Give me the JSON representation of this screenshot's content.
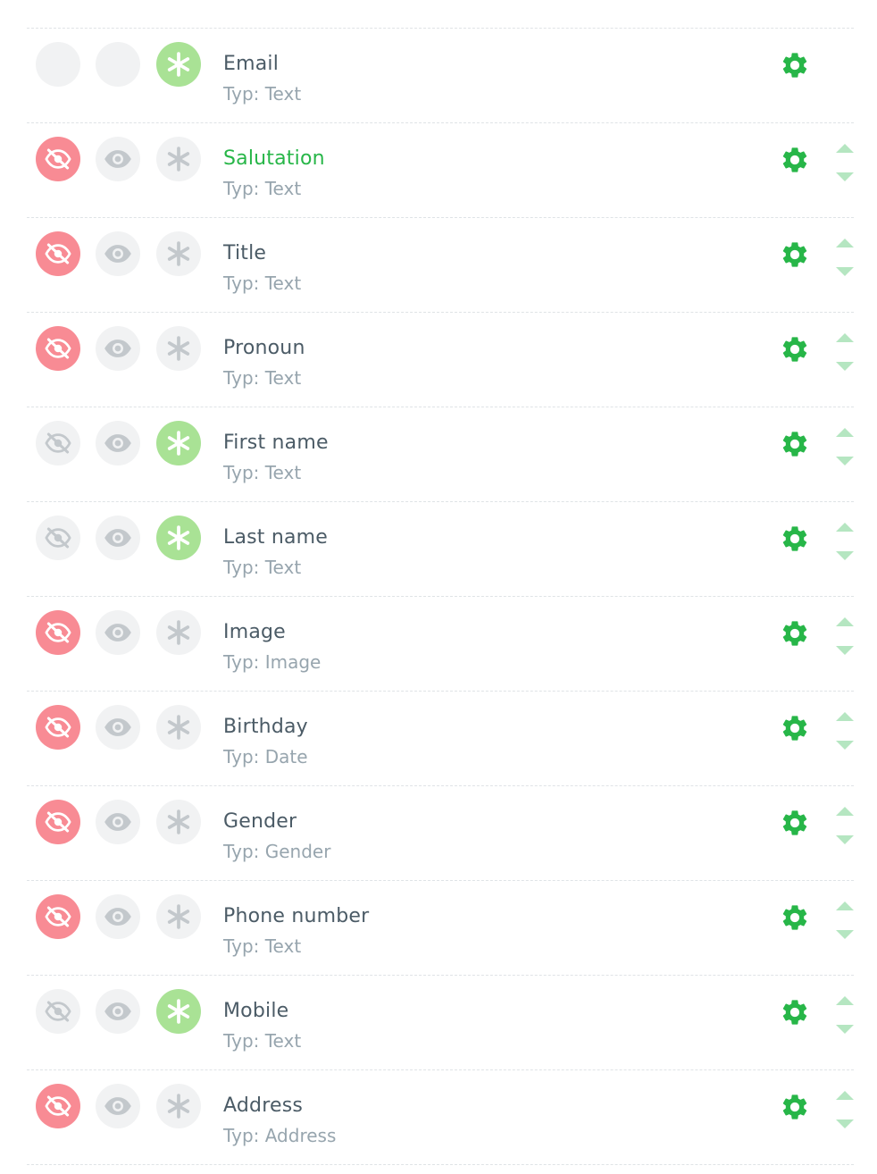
{
  "colors": {
    "accent_green": "#27b648",
    "hidden_active": "#f88b94",
    "required_active": "#a9e295",
    "inactive_circle": "#f1f2f3",
    "icon_inactive": "#c3c8cc",
    "arrow": "#b5e6c1"
  },
  "fields": [
    {
      "label": "Email",
      "type": "Typ: Text",
      "hidden": "none",
      "visible": "none",
      "required": true,
      "active": false,
      "arrows": false
    },
    {
      "label": "Salutation",
      "type": "Typ: Text",
      "hidden": "on",
      "visible": "off",
      "required": false,
      "active": true,
      "arrows": true
    },
    {
      "label": "Title",
      "type": "Typ: Text",
      "hidden": "on",
      "visible": "off",
      "required": false,
      "active": false,
      "arrows": true
    },
    {
      "label": "Pronoun",
      "type": "Typ: Text",
      "hidden": "on",
      "visible": "off",
      "required": false,
      "active": false,
      "arrows": true
    },
    {
      "label": "First name",
      "type": "Typ: Text",
      "hidden": "off",
      "visible": "off",
      "required": true,
      "active": false,
      "arrows": true
    },
    {
      "label": "Last name",
      "type": "Typ: Text",
      "hidden": "off",
      "visible": "off",
      "required": true,
      "active": false,
      "arrows": true
    },
    {
      "label": "Image",
      "type": "Typ: Image",
      "hidden": "on",
      "visible": "off",
      "required": false,
      "active": false,
      "arrows": true
    },
    {
      "label": "Birthday",
      "type": "Typ: Date",
      "hidden": "on",
      "visible": "off",
      "required": false,
      "active": false,
      "arrows": true
    },
    {
      "label": "Gender",
      "type": "Typ: Gender",
      "hidden": "on",
      "visible": "off",
      "required": false,
      "active": false,
      "arrows": true
    },
    {
      "label": "Phone number",
      "type": "Typ: Text",
      "hidden": "on",
      "visible": "off",
      "required": false,
      "active": false,
      "arrows": true
    },
    {
      "label": "Mobile",
      "type": "Typ: Text",
      "hidden": "off",
      "visible": "off",
      "required": true,
      "active": false,
      "arrows": true
    },
    {
      "label": "Address",
      "type": "Typ: Address",
      "hidden": "on",
      "visible": "off",
      "required": false,
      "active": false,
      "arrows": true
    }
  ],
  "icons": {
    "hidden": "eye-slash-icon",
    "visible": "eye-icon",
    "required": "asterisk-icon",
    "settings": "gear-icon",
    "move_up": "arrow-up-icon",
    "move_down": "arrow-down-icon"
  }
}
